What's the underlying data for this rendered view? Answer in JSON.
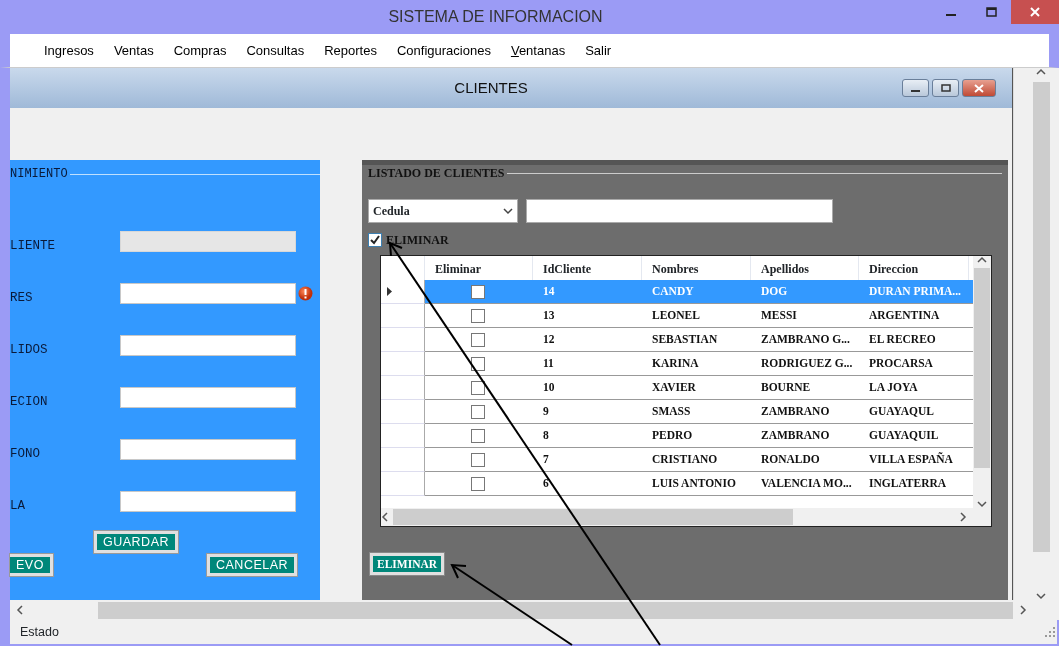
{
  "window": {
    "title": "SISTEMA DE INFORMACION"
  },
  "menu": [
    {
      "label": "Ingresos",
      "mnemonic_underlined": false
    },
    {
      "label": "Ventas",
      "mnemonic_underlined": false
    },
    {
      "label": "Compras",
      "mnemonic_underlined": false
    },
    {
      "label": "Consultas",
      "mnemonic_underlined": false
    },
    {
      "label": "Reportes",
      "mnemonic_underlined": false
    },
    {
      "label": "Configuraciones",
      "mnemonic_underlined": false
    },
    {
      "label": "Ventanas",
      "mnemonic_underlined": true
    },
    {
      "label": "Salir",
      "mnemonic_underlined": false
    }
  ],
  "child_window": {
    "title": "CLIENTES",
    "left_panel": {
      "legend": "NIMIENTO",
      "fields": [
        {
          "label": "LIENTE",
          "disabled": true,
          "error": false
        },
        {
          "label": "RES",
          "disabled": false,
          "error": true
        },
        {
          "label": "LIDOS",
          "disabled": false,
          "error": false
        },
        {
          "label": "ECION",
          "disabled": false,
          "error": false
        },
        {
          "label": "FONO",
          "disabled": false,
          "error": false
        },
        {
          "label": "LA",
          "disabled": false,
          "error": false
        }
      ],
      "buttons": [
        "GUARDAR",
        "EVO",
        "CANCELAR"
      ]
    },
    "right_panel": {
      "legend": "LISTADO DE CLIENTES",
      "filter_select": "Cedula",
      "delete_checkbox": {
        "label": "ELIMINAR",
        "checked": true
      },
      "grid": {
        "columns": [
          "Eliminar",
          "IdCliente",
          "Nombres",
          "Apellidos",
          "Direccion"
        ],
        "rows": [
          {
            "selected": true,
            "checked": false,
            "cells": [
              "",
              "14",
              "CANDY",
              "DOG",
              "DURAN PRIMA..."
            ]
          },
          {
            "selected": false,
            "checked": false,
            "cells": [
              "",
              "13",
              "LEONEL",
              "MESSI",
              "ARGENTINA"
            ]
          },
          {
            "selected": false,
            "checked": false,
            "cells": [
              "",
              "12",
              "SEBASTIAN",
              "ZAMBRANO G...",
              "EL RECREO"
            ]
          },
          {
            "selected": false,
            "checked": false,
            "cells": [
              "",
              "11",
              "KARINA",
              "RODRIGUEZ G...",
              "PROCARSA"
            ]
          },
          {
            "selected": false,
            "checked": false,
            "cells": [
              "",
              "10",
              "XAVIER",
              "BOURNE",
              "LA JOYA"
            ]
          },
          {
            "selected": false,
            "checked": false,
            "cells": [
              "",
              "9",
              "SMASS",
              "ZAMBRANO",
              "GUAYAQUL"
            ]
          },
          {
            "selected": false,
            "checked": false,
            "cells": [
              "",
              "8",
              "PEDRO",
              "ZAMBRANO",
              "GUAYAQUIL"
            ]
          },
          {
            "selected": false,
            "checked": false,
            "cells": [
              "",
              "7",
              "CRISTIANO",
              "RONALDO",
              "VILLA ESPAÑA"
            ]
          },
          {
            "selected": false,
            "checked": false,
            "cells": [
              "",
              "6",
              "LUIS ANTONIO",
              "VALENCIA MO...",
              "INGLATERRA"
            ]
          }
        ]
      },
      "button": "ELIMINAR"
    }
  },
  "status_bar": "Estado"
}
